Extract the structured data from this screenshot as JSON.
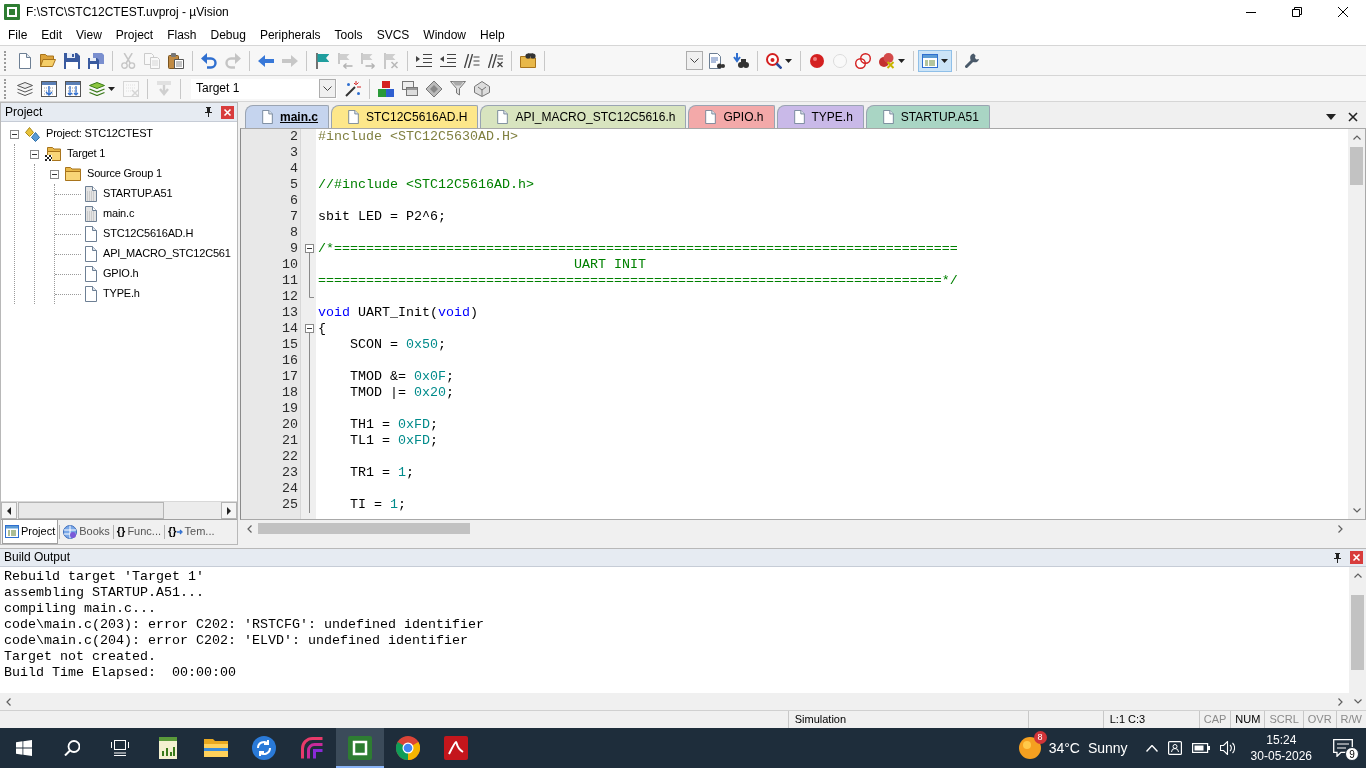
{
  "window": {
    "title": "F:\\STC\\STC12CTEST.uvproj - µVision"
  },
  "menu": [
    "File",
    "Edit",
    "View",
    "Project",
    "Flash",
    "Debug",
    "Peripherals",
    "Tools",
    "SVCS",
    "Window",
    "Help"
  ],
  "toolbars": [
    {
      "groups": [
        [
          {
            "kind": "button",
            "disabled": false,
            "pressed": false
          },
          {
            "kind": "button",
            "disabled": false,
            "pressed": false
          },
          {
            "kind": "button",
            "disabled": false,
            "pressed": false
          },
          {
            "kind": "button",
            "disabled": false,
            "pressed": false
          }
        ],
        [
          {
            "kind": "button",
            "disabled": true,
            "pressed": false
          },
          {
            "kind": "button",
            "disabled": true,
            "pressed": false
          },
          {
            "kind": "button",
            "disabled": false,
            "pressed": false
          }
        ],
        [
          {
            "kind": "button",
            "disabled": false,
            "pressed": false
          },
          {
            "kind": "button",
            "disabled": true,
            "pressed": false
          }
        ],
        [
          {
            "kind": "button",
            "disabled": false,
            "pressed": false
          },
          {
            "kind": "button",
            "disabled": true,
            "pressed": false
          }
        ],
        [
          {
            "kind": "button",
            "disabled": false,
            "pressed": false
          },
          {
            "kind": "button",
            "disabled": true,
            "pressed": false
          },
          {
            "kind": "button",
            "disabled": true,
            "pressed": false
          },
          {
            "kind": "button",
            "disabled": true,
            "pressed": false
          }
        ],
        [
          {
            "kind": "button",
            "disabled": false,
            "pressed": false
          },
          {
            "kind": "button",
            "disabled": false,
            "pressed": false
          },
          {
            "kind": "button",
            "disabled": false,
            "pressed": false
          },
          {
            "kind": "button",
            "disabled": false,
            "pressed": false
          }
        ],
        [
          {
            "kind": "button",
            "disabled": false,
            "pressed": false
          }
        ],
        [
          {
            "kind": "combo"
          },
          {
            "kind": "button",
            "disabled": false,
            "pressed": false
          },
          {
            "kind": "button",
            "disabled": false,
            "pressed": false
          }
        ],
        [
          {
            "kind": "split",
            "disabled": false,
            "pressed": false
          }
        ],
        [
          {
            "kind": "button",
            "disabled": false,
            "pressed": false
          },
          {
            "kind": "button",
            "disabled": true,
            "pressed": false
          },
          {
            "kind": "button",
            "disabled": false,
            "pressed": false
          },
          {
            "kind": "split",
            "disabled": false,
            "pressed": false
          }
        ],
        [
          {
            "kind": "split",
            "disabled": false,
            "pressed": true
          }
        ],
        [
          {
            "kind": "button",
            "disabled": false,
            "pressed": false
          }
        ]
      ]
    },
    {
      "groups": [
        [
          {
            "kind": "button",
            "disabled": false,
            "pressed": false
          },
          {
            "kind": "button",
            "disabled": false,
            "pressed": false
          },
          {
            "kind": "button",
            "disabled": false,
            "pressed": false
          },
          {
            "kind": "split",
            "disabled": false,
            "pressed": false
          },
          {
            "kind": "button",
            "disabled": true,
            "pressed": false
          }
        ],
        [
          {
            "kind": "button",
            "disabled": true,
            "pressed": false
          }
        ],
        [
          {
            "kind": "select",
            "value": "Target 1"
          },
          {
            "kind": "button",
            "disabled": false,
            "pressed": false
          }
        ],
        [
          {
            "kind": "button",
            "disabled": false,
            "pressed": false
          },
          {
            "kind": "button",
            "disabled": false,
            "pressed": false
          },
          {
            "kind": "button",
            "disabled": false,
            "pressed": false
          },
          {
            "kind": "button",
            "disabled": false,
            "pressed": false
          },
          {
            "kind": "button",
            "disabled": false,
            "pressed": false
          }
        ]
      ]
    }
  ],
  "project_panel": {
    "title": "Project",
    "tree": [
      {
        "label": "Project: STC12CTEST",
        "kind": "project",
        "expanded": true,
        "children": [
          {
            "label": "Target 1",
            "kind": "target",
            "expanded": true,
            "children": [
              {
                "label": "Source Group 1",
                "kind": "group",
                "expanded": true,
                "children": [
                  {
                    "label": "STARTUP.A51",
                    "kind": "source"
                  },
                  {
                    "label": "main.c",
                    "kind": "source"
                  },
                  {
                    "label": "STC12C5616AD.H",
                    "kind": "header"
                  },
                  {
                    "label": "API_MACRO_STC12C561",
                    "kind": "header"
                  },
                  {
                    "label": "GPIO.h",
                    "kind": "header"
                  },
                  {
                    "label": "TYPE.h",
                    "kind": "header"
                  }
                ]
              }
            ]
          }
        ]
      }
    ],
    "tabs": [
      {
        "label": "Project",
        "selected": true
      },
      {
        "label": "Books",
        "selected": false
      },
      {
        "label": "Func...",
        "glyph": "{}",
        "selected": false
      },
      {
        "label": "Tem...",
        "glyph": "{}",
        "selected": false
      }
    ]
  },
  "editor": {
    "tabs": [
      {
        "label": "main.c",
        "color": "#c5d4ee",
        "selected": true
      },
      {
        "label": "STC12C5616AD.H",
        "color": "#fde78a",
        "selected": false
      },
      {
        "label": "API_MACRO_STC12C5616.h",
        "color": "#d8e4bf",
        "selected": false
      },
      {
        "label": "GPIO.h",
        "color": "#f3a9a9",
        "selected": false
      },
      {
        "label": "TYPE.h",
        "color": "#c9b9e8",
        "selected": false
      },
      {
        "label": "STARTUP.A51",
        "color": "#a9d5c4",
        "selected": false
      }
    ],
    "lines": [
      {
        "number": "2",
        "tokens": [
          {
            "text": "#include <STC12C5630AD.H>",
            "kind": "preprocessor"
          }
        ]
      },
      {
        "number": "3"
      },
      {
        "number": "4"
      },
      {
        "number": "5",
        "tokens": [
          {
            "text": "//#include <STC12C5616AD.h>",
            "kind": "comment"
          }
        ]
      },
      {
        "number": "6"
      },
      {
        "number": "7",
        "tokens": [
          {
            "text": "sbit LED = P2^6;",
            "kind": "plain"
          }
        ]
      },
      {
        "number": "8"
      },
      {
        "number": "9",
        "expanded": true,
        "tokens": [
          {
            "text": "/*==============================================================================",
            "kind": "comment"
          }
        ],
        "children": [
          {
            "number": "10",
            "tokens": [
              {
                "text": "                                UART INIT",
                "kind": "comment"
              }
            ]
          },
          {
            "number": "11",
            "tokens": [
              {
                "text": "==============================================================================*/",
                "kind": "comment"
              }
            ]
          },
          {
            "number": "12"
          }
        ]
      },
      {
        "number": "13",
        "tokens": [
          {
            "text": "void",
            "kind": "keyword"
          },
          {
            "text": " UART_Init(",
            "kind": "plain"
          },
          {
            "text": "void",
            "kind": "keyword"
          },
          {
            "text": ")",
            "kind": "plain"
          }
        ]
      },
      {
        "number": "14",
        "expanded": true,
        "tokens": [
          {
            "text": "{",
            "kind": "plain"
          }
        ],
        "children": [
          {
            "number": "15",
            "tokens": [
              {
                "text": "    SCON = ",
                "kind": "plain"
              },
              {
                "text": "0x50",
                "kind": "number"
              },
              {
                "text": ";",
                "kind": "plain"
              }
            ]
          },
          {
            "number": "16"
          },
          {
            "number": "17",
            "tokens": [
              {
                "text": "    TMOD &= ",
                "kind": "plain"
              },
              {
                "text": "0x0F",
                "kind": "number"
              },
              {
                "text": ";",
                "kind": "plain"
              }
            ]
          },
          {
            "number": "18",
            "tokens": [
              {
                "text": "    TMOD |= ",
                "kind": "plain"
              },
              {
                "text": "0x20",
                "kind": "number"
              },
              {
                "text": ";",
                "kind": "plain"
              }
            ]
          },
          {
            "number": "19"
          },
          {
            "number": "20",
            "tokens": [
              {
                "text": "    TH1 = ",
                "kind": "plain"
              },
              {
                "text": "0xFD",
                "kind": "number"
              },
              {
                "text": ";",
                "kind": "plain"
              }
            ]
          },
          {
            "number": "21",
            "tokens": [
              {
                "text": "    TL1 = ",
                "kind": "plain"
              },
              {
                "text": "0xFD",
                "kind": "number"
              },
              {
                "text": ";",
                "kind": "plain"
              }
            ]
          },
          {
            "number": "22"
          },
          {
            "number": "23",
            "tokens": [
              {
                "text": "    TR1 = ",
                "kind": "plain"
              },
              {
                "text": "1",
                "kind": "number"
              },
              {
                "text": ";",
                "kind": "plain"
              }
            ]
          },
          {
            "number": "24"
          },
          {
            "number": "25",
            "tokens": [
              {
                "text": "    TI = ",
                "kind": "plain"
              },
              {
                "text": "1",
                "kind": "number"
              },
              {
                "text": ";",
                "kind": "plain"
              }
            ]
          }
        ]
      }
    ]
  },
  "build_output": {
    "title": "Build Output",
    "lines": [
      "Rebuild target 'Target 1'",
      "assembling STARTUP.A51...",
      "compiling main.c...",
      "code\\main.c(203): error C202: 'RSTCFG': undefined identifier",
      "code\\main.c(204): error C202: 'ELVD': undefined identifier",
      "Target not created.",
      "Build Time Elapsed:  00:00:00"
    ]
  },
  "status_bar": {
    "mode": "Simulation",
    "position": "L:1 C:3",
    "indicators": [
      {
        "label": "CAP",
        "on": false
      },
      {
        "label": "NUM",
        "on": true
      },
      {
        "label": "SCRL",
        "on": false
      },
      {
        "label": "OVR",
        "on": false
      },
      {
        "label": "R/W",
        "on": false
      }
    ]
  },
  "taskbar": {
    "apps": [
      {
        "selected": false
      },
      {
        "selected": false
      },
      {
        "selected": false
      },
      {
        "selected": false
      },
      {
        "selected": true
      },
      {
        "selected": false
      },
      {
        "selected": false
      }
    ],
    "weather": {
      "badge": "8",
      "temperature": "34°C",
      "condition": "Sunny"
    },
    "time": "15:24",
    "date": "30-05-2026",
    "notification_count": "9"
  }
}
